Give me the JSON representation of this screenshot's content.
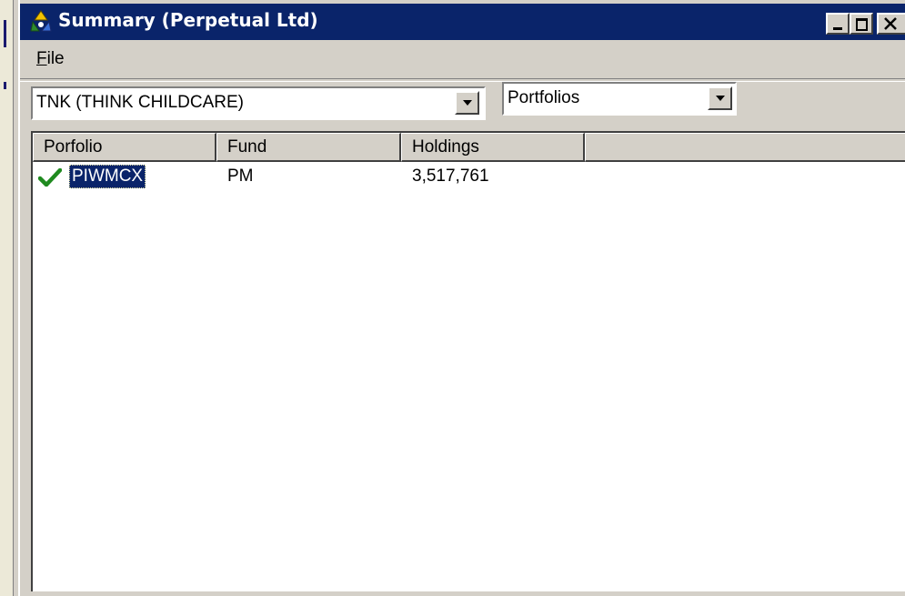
{
  "window": {
    "title": "Summary (Perpetual Ltd)",
    "icon": "recycle-icon"
  },
  "menu": {
    "file_label": {
      "mnemonic": "F",
      "rest": "ile"
    }
  },
  "security_combo": {
    "value": "TNK (THINK CHILDCARE)"
  },
  "view_combo": {
    "value": "Portfolios"
  },
  "table": {
    "columns": [
      "Porfolio",
      "Fund",
      "Holdings",
      ""
    ],
    "rows": [
      {
        "portfolio": "PIWMCX",
        "fund": "PM",
        "holdings": "3,517,761",
        "status_icon": "check-icon",
        "selected": true
      }
    ]
  },
  "colors": {
    "titlebar": "#0a246a",
    "face": "#d4d0c8",
    "check": "#1f8a1f"
  }
}
